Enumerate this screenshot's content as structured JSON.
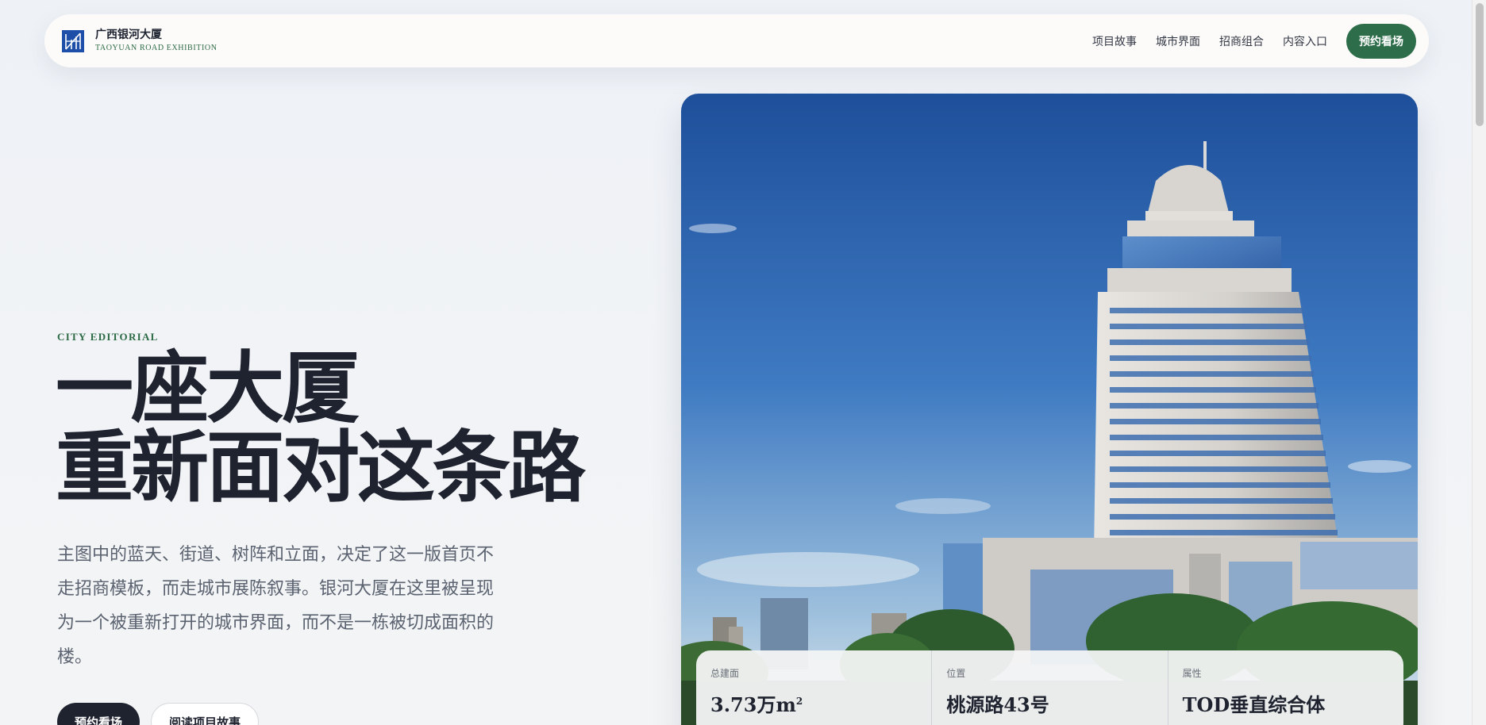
{
  "header": {
    "brand_name": "广西银河大厦",
    "brand_sub": "TAOYUAN ROAD EXHIBITION",
    "nav": [
      "项目故事",
      "城市界面",
      "招商组合",
      "内容入口"
    ],
    "cta": "预约看场"
  },
  "hero": {
    "kicker": "CITY EDITORIAL",
    "headline_line1": "一座大厦",
    "headline_line2": "重新面对这条路",
    "lede": "主图中的蓝天、街道、树阵和立面，决定了这一版首页不走招商模板，而走城市展陈叙事。银河大厦在这里被呈现为一个被重新打开的城市界面，而不是一栋被切成面积的楼。",
    "primary_button": "预约看场",
    "secondary_button": "阅读项目故事"
  },
  "stats": [
    {
      "label": "总建面",
      "value": "3.73万m",
      "sup": "2"
    },
    {
      "label": "位置",
      "value": "桃源路43号",
      "sup": ""
    },
    {
      "label": "属性",
      "value": "TOD垂直综合体",
      "sup": ""
    }
  ],
  "colors": {
    "accent_green": "#2d6d4a",
    "ink": "#1f2330",
    "logo_blue": "#1e4fa8",
    "sky_top": "#1e4f9a",
    "sky_bottom": "#dfe8ef"
  },
  "icons": {
    "logo": "building-logo-icon"
  }
}
